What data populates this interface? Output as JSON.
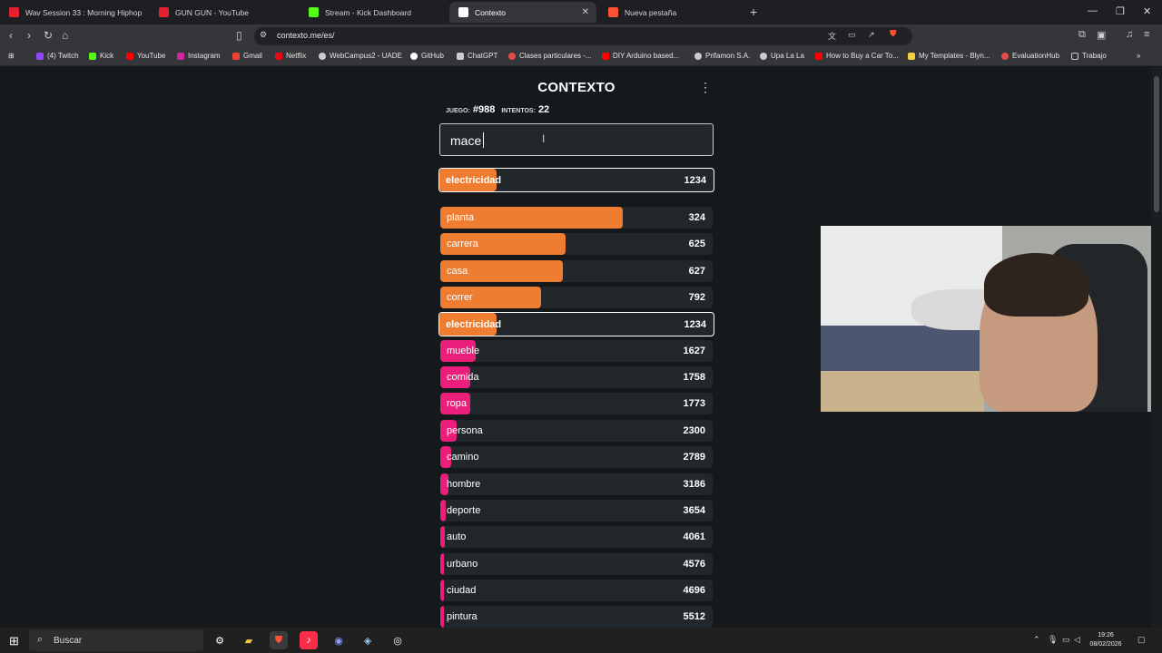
{
  "browser": {
    "tabs": [
      {
        "title": "Wav Session 33 : Morning Hiphop",
        "color": "#e4202e",
        "active": false
      },
      {
        "title": "GUN GUN - YouTube",
        "color": "#e4202e",
        "active": false
      },
      {
        "title": "Stream - Kick Dashboard",
        "color": "#53fc18",
        "active": false
      },
      {
        "title": "Contexto",
        "color": "#ffffff",
        "active": true
      },
      {
        "title": "Nueva pestaña",
        "color": "#ff5133",
        "active": false
      }
    ],
    "url": "contexto.me/es/",
    "bookmarks": [
      {
        "label": "(4) Twitch",
        "color": "#9146ff"
      },
      {
        "label": "Kick",
        "color": "#53fc18"
      },
      {
        "label": "YouTube",
        "color": "#ff0000"
      },
      {
        "label": "Instagram",
        "color": "#d6249f"
      },
      {
        "label": "Gmail",
        "color": "#ea4335"
      },
      {
        "label": "Netflix",
        "color": "#e50914"
      },
      {
        "label": "WebCampus2 - UADE",
        "color": "#cccccc"
      },
      {
        "label": "GitHub",
        "color": "#ffffff"
      },
      {
        "label": "ChatGPT",
        "color": "#cccccc"
      },
      {
        "label": "Clases particulares -...",
        "color": "#e24b4b"
      },
      {
        "label": "DIY Arduino based...",
        "color": "#ff0000"
      },
      {
        "label": "Prifamon S.A.",
        "color": "#cccccc"
      },
      {
        "label": "Upa La La",
        "color": "#cccccc"
      },
      {
        "label": "How to Buy a Car To...",
        "color": "#ff0000"
      },
      {
        "label": "My Templates - Blyn...",
        "color": "#f4d03f"
      },
      {
        "label": "EvaluationHub",
        "color": "#e24b4b"
      },
      {
        "label": "Trabajo",
        "color": "#cccccc"
      }
    ]
  },
  "game": {
    "title": "CONTEXTO",
    "game_label": "JUEGO:",
    "game_number": "#988",
    "attempts_label": "INTENTOS:",
    "attempts": "22",
    "input_value": "mace",
    "last_guess": {
      "word": "electricidad",
      "rank": "1234",
      "fill": 0.21
    },
    "guesses": [
      {
        "word": "planta",
        "rank": "324",
        "fill": 0.67
      },
      {
        "word": "carrera",
        "rank": "625",
        "fill": 0.46
      },
      {
        "word": "casa",
        "rank": "627",
        "fill": 0.45
      },
      {
        "word": "correr",
        "rank": "792",
        "fill": 0.37
      },
      {
        "word": "electricidad",
        "rank": "1234",
        "fill": 0.21,
        "highlight": true
      },
      {
        "word": "mueble",
        "rank": "1627",
        "fill": 0.13
      },
      {
        "word": "comida",
        "rank": "1758",
        "fill": 0.11
      },
      {
        "word": "ropa",
        "rank": "1773",
        "fill": 0.11
      },
      {
        "word": "persona",
        "rank": "2300",
        "fill": 0.06
      },
      {
        "word": "camino",
        "rank": "2789",
        "fill": 0.04
      },
      {
        "word": "hombre",
        "rank": "3186",
        "fill": 0.03
      },
      {
        "word": "deporte",
        "rank": "3654",
        "fill": 0.02
      },
      {
        "word": "auto",
        "rank": "4061",
        "fill": 0.015
      },
      {
        "word": "urbano",
        "rank": "4576",
        "fill": 0.01
      },
      {
        "word": "ciudad",
        "rank": "4696",
        "fill": 0.01
      },
      {
        "word": "pintura",
        "rank": "5512",
        "fill": 0.01
      }
    ],
    "colors": {
      "orange": "#ef7d31",
      "pink": "#eb1e7c"
    }
  },
  "taskbar": {
    "search_placeholder": "Buscar",
    "time": "19:26",
    "date": "08/02/2026"
  }
}
